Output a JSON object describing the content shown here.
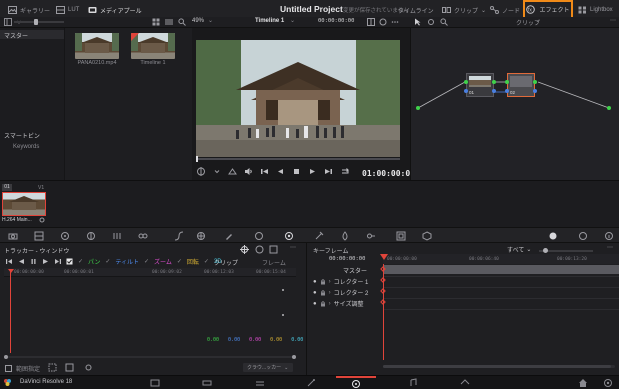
{
  "topbar": {
    "gallery": "ギャラリー",
    "lut": "LUT",
    "mediapool": "メディアプール",
    "project_title": "Untitled Project",
    "status": "変更が保存されていません",
    "timeline_tab": "タイムライン",
    "clips": "クリップ",
    "nodes": "ノード",
    "effects": "エフェクト",
    "lightbox": "Lightbox"
  },
  "subbar": {
    "zoom": "49%",
    "timeline_name": "Timeline 1",
    "timecode": "00:00:00:00",
    "clip_mode": "クリップ"
  },
  "mediapool": {
    "master": "マスター",
    "smart_bins": "スマートビン",
    "keywords": "Keywords",
    "items": [
      {
        "label": "PANA0210.mp4"
      },
      {
        "label": "Timeline 1"
      }
    ]
  },
  "viewer": {
    "timecode": "01:00:00:00"
  },
  "node_editor": {
    "nodes": [
      {
        "label": "01"
      },
      {
        "label": "02"
      }
    ]
  },
  "clipstrip": {
    "index": "01",
    "track": "V1",
    "clip_label": "H.264 Main..."
  },
  "tracker": {
    "title": "トラッカー - ウィンドウ",
    "filters": [
      "パン",
      "ティルト",
      "ズーム",
      "回転",
      "3D"
    ],
    "filter_colors": [
      "#3fd24a",
      "#4f8df0",
      "#e04fd3",
      "#d9b234",
      "#4dd0e8"
    ],
    "mode_clip": "クリップ",
    "mode_frame": "フレーム",
    "ruler": [
      "00:00:00:00",
      "00:00:00:01",
      "00:00:09:02",
      "00:00:12:03",
      "00:00:15:04"
    ],
    "values": [
      "0.00",
      "0.00",
      "0.00",
      "0.00",
      "0.00"
    ],
    "value_colors": [
      "#3fd24a",
      "#4f8df0",
      "#e04fd3",
      "#d9b234",
      "#4dd0e8"
    ],
    "interactive": "範囲指定",
    "clouds": "クラウ...ッカー"
  },
  "keyframes": {
    "title": "キーフレーム",
    "all": "すべて",
    "timecode": "00:00:00:00",
    "ruler": [
      "00:00:00:00",
      "00:00:06:40",
      "00:00:13:20"
    ],
    "tracks": [
      {
        "label": "マスター"
      },
      {
        "label": "コレクター 1"
      },
      {
        "label": "コレクター 2"
      },
      {
        "label": "サイズ調整"
      }
    ]
  },
  "footer": {
    "app_name": "DaVinci Resolve 18"
  },
  "colors": {
    "accent_orange": "#f08a18",
    "playhead_red": "#e0443a"
  }
}
